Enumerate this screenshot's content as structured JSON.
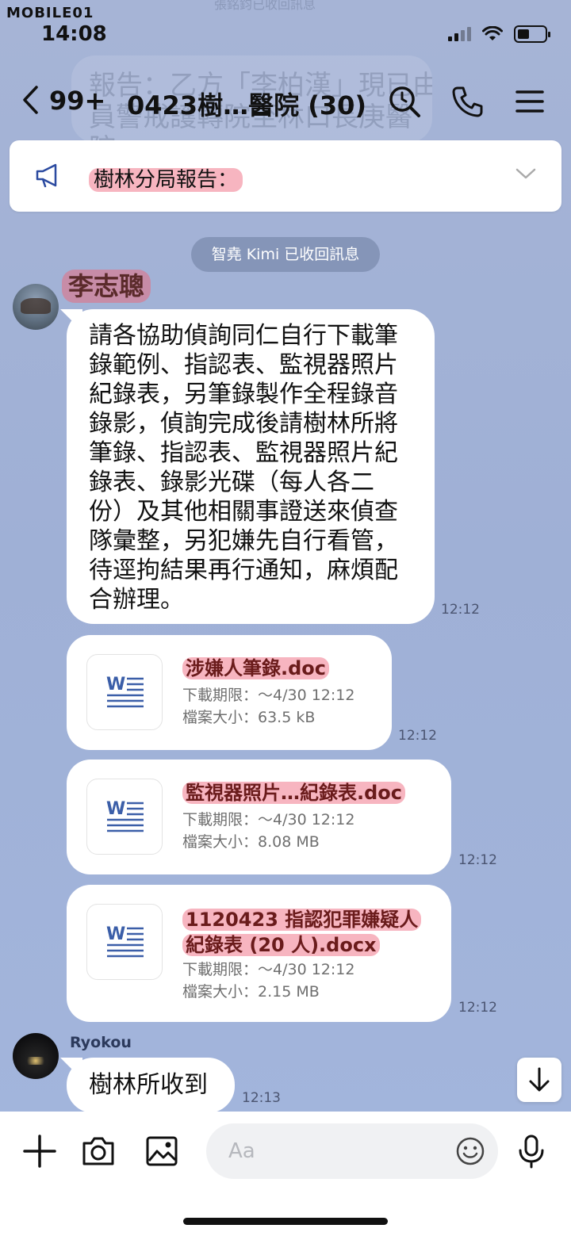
{
  "watermark": "MOBILE01",
  "status_bar": {
    "time": "14:08"
  },
  "background_ghost": {
    "top_text": "張銘鈞已收回訊息",
    "line1": "報告：乙方「李柏漢」現已由",
    "line2": "員警戒護轉院至林口長庚醫",
    "line3": "院。"
  },
  "header": {
    "back_icon": "chevron-left",
    "unread_count": "99+",
    "title": "0423樹…醫院 (30)",
    "icons": [
      "search-icon",
      "phone-icon",
      "menu-icon"
    ]
  },
  "announcement": {
    "icon": "megaphone-icon",
    "text": "樹林分局報告：",
    "expand_icon": "chevron-down-icon"
  },
  "system_message": "智堯 Kimi 已收回訊息",
  "messages": [
    {
      "sender": "李志聰",
      "type": "text",
      "lines": [
        "請各協助偵詢同仁自行下載筆",
        "錄範例、指認表、監視器照片",
        "紀錄表，另筆錄製作全程錄音",
        "錄影，偵詢完成後請樹林所將",
        "筆錄、指認表、監視器照片紀",
        "錄表、錄影光碟（每人各二",
        "份）及其他相關事證送來偵查",
        "隊彙整，另犯嫌先自行看管，",
        "待逕拘結果再行通知，麻煩配",
        "合辦理。"
      ],
      "time": "12:12"
    },
    {
      "type": "file",
      "name_lines": [
        "涉嫌人筆錄.doc"
      ],
      "expiry": "下載期限：～4/30 12:12",
      "size": "檔案大小：63.5 kB",
      "time": "12:12"
    },
    {
      "type": "file",
      "name_lines": [
        "監視器照片…紀錄表.doc"
      ],
      "expiry": "下載期限：～4/30 12:12",
      "size": "檔案大小：8.08 MB",
      "time": "12:12"
    },
    {
      "type": "file",
      "name_lines": [
        "1120423 指認犯罪嫌疑人",
        "紀錄表 (20 人).docx"
      ],
      "expiry": "下載期限：～4/30 12:12",
      "size": "檔案大小：2.15 MB",
      "time": "12:12"
    },
    {
      "sender": "Ryokou",
      "type": "text",
      "text": "樹林所收到",
      "time": "12:13"
    }
  ],
  "input_bar": {
    "placeholder": "Aa",
    "icons": [
      "plus-icon",
      "camera-icon",
      "image-icon",
      "emoji-icon",
      "microphone-icon"
    ]
  }
}
